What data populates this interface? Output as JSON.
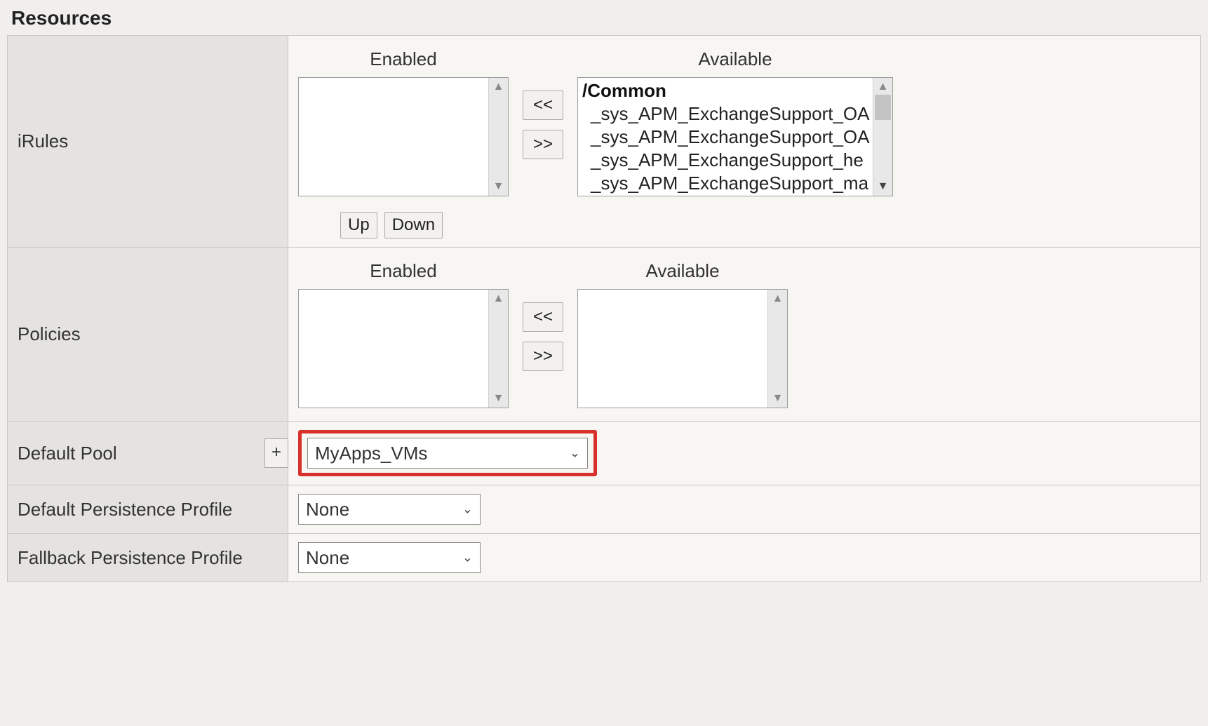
{
  "section_title": "Resources",
  "headers": {
    "enabled": "Enabled",
    "available": "Available"
  },
  "buttons": {
    "move_left": "<<",
    "move_right": ">>",
    "up": "Up",
    "down": "Down",
    "plus": "+"
  },
  "irules": {
    "label": "iRules",
    "enabled_items": [],
    "available_group": "/Common",
    "available_items": [
      "_sys_APM_ExchangeSupport_OA",
      "_sys_APM_ExchangeSupport_OA",
      "_sys_APM_ExchangeSupport_he",
      "_sys_APM_ExchangeSupport_ma"
    ]
  },
  "policies": {
    "label": "Policies",
    "enabled_items": [],
    "available_items": []
  },
  "default_pool": {
    "label": "Default Pool",
    "selected": "MyApps_VMs"
  },
  "default_persistence": {
    "label": "Default Persistence Profile",
    "selected": "None"
  },
  "fallback_persistence": {
    "label": "Fallback Persistence Profile",
    "selected": "None"
  }
}
